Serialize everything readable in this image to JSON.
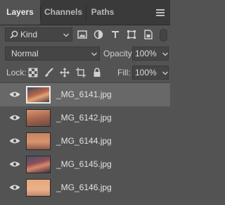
{
  "tabs": [
    {
      "label": "Layers",
      "active": true
    },
    {
      "label": "Channels",
      "active": false
    },
    {
      "label": "Paths",
      "active": false
    }
  ],
  "filter": {
    "label": "Kind",
    "icons": [
      "search-icon",
      "image-filter-icon",
      "adjustment-filter-icon",
      "type-filter-icon",
      "shape-filter-icon",
      "smart-object-filter-icon"
    ]
  },
  "blend": {
    "mode": "Normal",
    "opacity_label": "Opacity:",
    "opacity_value": "100%"
  },
  "lock": {
    "label": "Lock:",
    "fill_label": "Fill:",
    "fill_value": "100%",
    "icons": [
      "lock-transparent-pixels-icon",
      "lock-image-pixels-icon",
      "lock-position-icon",
      "lock-artboard-icon",
      "lock-all-icon"
    ]
  },
  "layers": [
    {
      "name": "_MG_6141.jpg",
      "selected": true,
      "visible": true
    },
    {
      "name": "_MG_6142.jpg",
      "selected": false,
      "visible": true
    },
    {
      "name": "_MG_6144.jpg",
      "selected": false,
      "visible": true
    },
    {
      "name": "_MG_6145.jpg",
      "selected": false,
      "visible": true
    },
    {
      "name": "_MG_6146.jpg",
      "selected": false,
      "visible": true
    }
  ],
  "colors": {
    "panel_bg": "#535353",
    "selected_row": "#686868",
    "tab_bar": "#3a3a3a"
  }
}
